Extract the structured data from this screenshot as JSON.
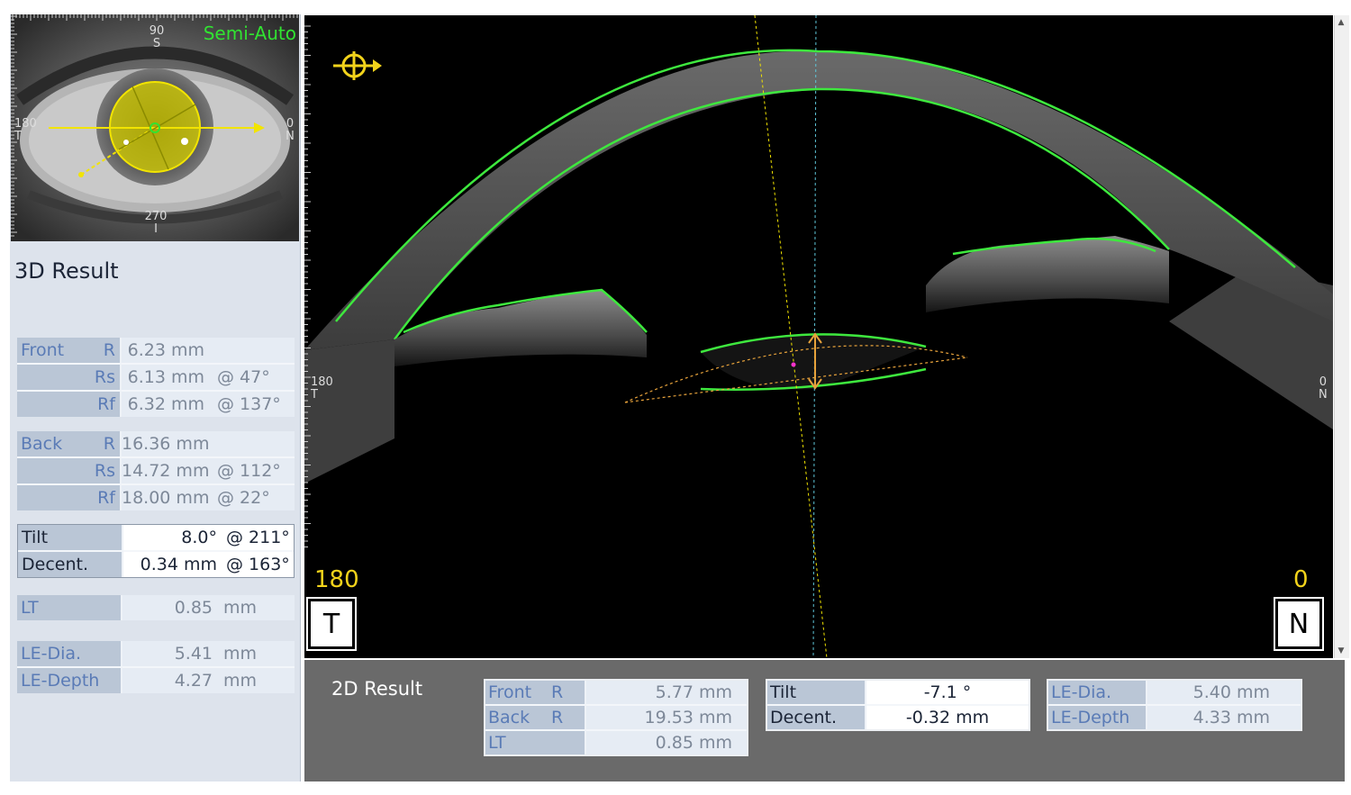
{
  "thumbnail": {
    "mode_label": "Semi-Auto",
    "top_label": "90\nS",
    "bottom_label": "270\nI",
    "left_label": "180\nT",
    "right_label": "0\nN"
  },
  "result3d": {
    "title": "3D Result",
    "front": {
      "label": "Front",
      "rows": [
        {
          "key": "R",
          "value": "6.23 mm",
          "angle": ""
        },
        {
          "key": "Rs",
          "value": "6.13 mm",
          "angle": "@ 47°"
        },
        {
          "key": "Rf",
          "value": "6.32 mm",
          "angle": "@ 137°"
        }
      ]
    },
    "back": {
      "label": "Back",
      "rows": [
        {
          "key": "R",
          "value": "16.36 mm",
          "angle": ""
        },
        {
          "key": "Rs",
          "value": "14.72 mm",
          "angle": "@ 112°"
        },
        {
          "key": "Rf",
          "value": "18.00 mm",
          "angle": "@ 22°"
        }
      ]
    },
    "tilt": {
      "label": "Tilt",
      "value": "8.0°",
      "angle": "@ 211°"
    },
    "decent": {
      "label": "Decent.",
      "value": "0.34 mm",
      "angle": "@ 163°"
    },
    "lt": {
      "label": "LT",
      "value": "0.85",
      "unit": "mm"
    },
    "le_dia": {
      "label": "LE-Dia.",
      "value": "5.41",
      "unit": "mm"
    },
    "le_depth": {
      "label": "LE-Depth",
      "value": "4.27",
      "unit": "mm"
    }
  },
  "scan": {
    "left_deg": "180",
    "right_deg": "0",
    "left_side": "T",
    "right_side": "N",
    "left_tick": "180\nT",
    "right_tick": "0\nN",
    "colors": {
      "boundary": "#3ee83e",
      "marker": "#f2d31b",
      "axis": "#5fc6d8"
    }
  },
  "result2d": {
    "title": "2D Result",
    "table1": [
      {
        "label": "Front",
        "key": "R",
        "value": "5.77 mm"
      },
      {
        "label": "Back",
        "key": "R",
        "value": "19.53 mm"
      },
      {
        "label": "LT",
        "key": "",
        "value": "0.85 mm"
      }
    ],
    "table2": [
      {
        "label": "Tilt",
        "value": "-7.1 °"
      },
      {
        "label": "Decent.",
        "value": "-0.32 mm"
      }
    ],
    "table3": [
      {
        "label": "LE-Dia.",
        "value": "5.40 mm"
      },
      {
        "label": "LE-Depth",
        "value": "4.33 mm"
      }
    ]
  }
}
